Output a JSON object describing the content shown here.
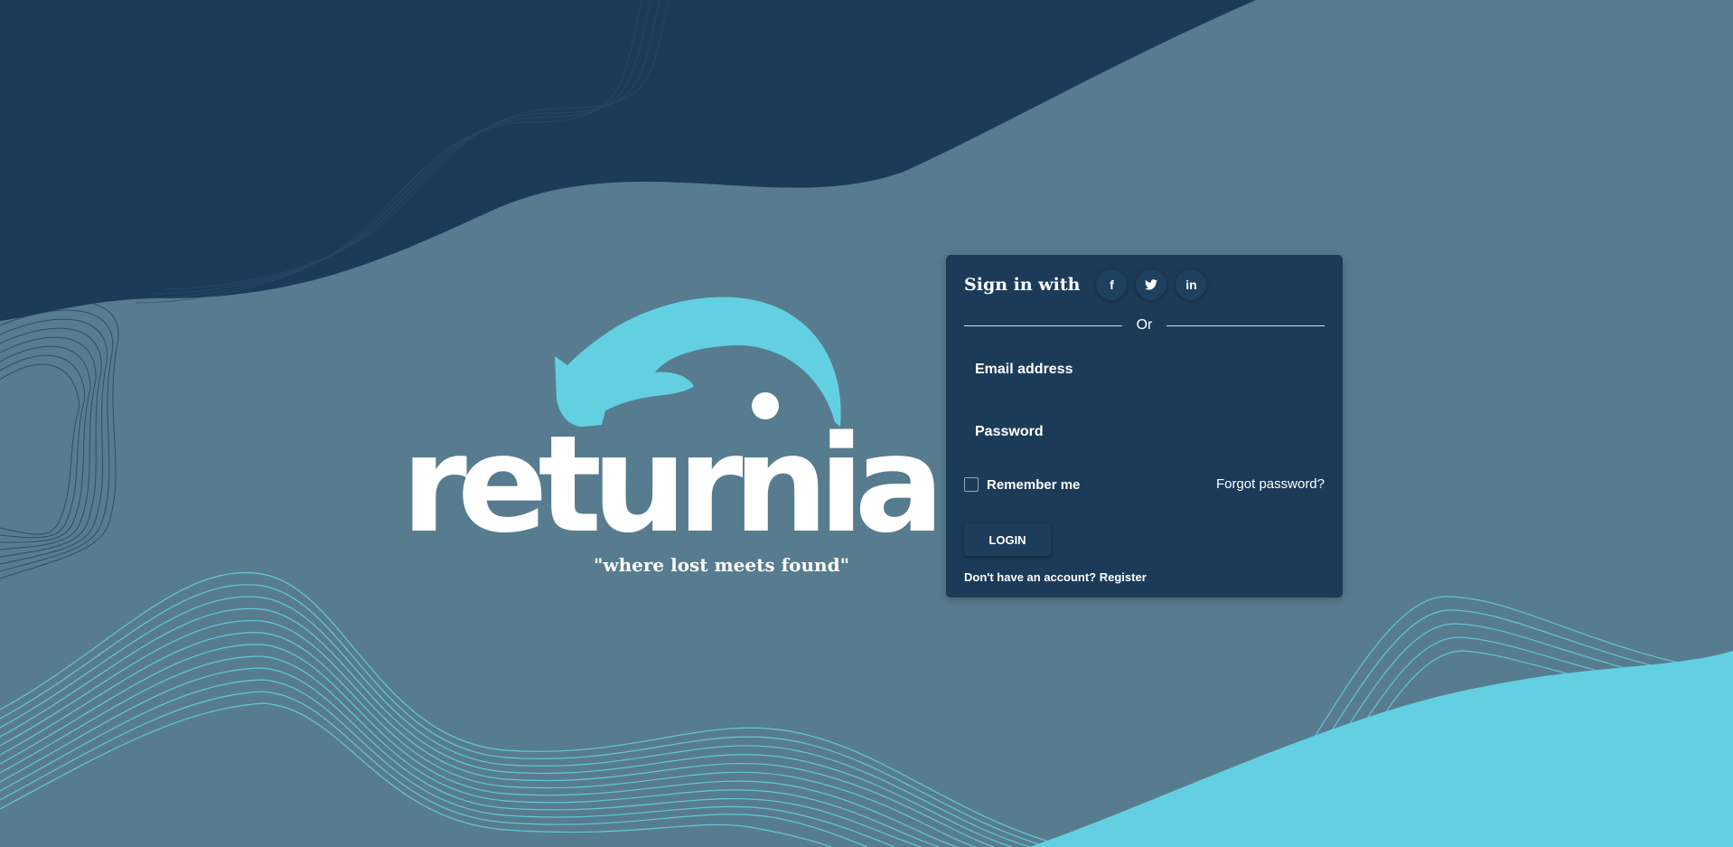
{
  "brand": {
    "wordmark": "returnia",
    "tagline": "\"where lost meets found\"",
    "accent_color": "#63d0e1"
  },
  "colors": {
    "background": "#577c8f",
    "dark_navy": "#1b3b59",
    "cyan": "#63d0e1",
    "card": "#1c3b59"
  },
  "login_card": {
    "signin_label": "Sign in with",
    "social": [
      {
        "icon": "facebook-icon",
        "glyph": "f"
      },
      {
        "icon": "twitter-icon",
        "glyph": "🐦"
      },
      {
        "icon": "linkedin-icon",
        "glyph": "in"
      }
    ],
    "divider_text": "Or",
    "email_placeholder": "Email address",
    "password_placeholder": "Password",
    "remember_label": "Remember me",
    "forgot_label": "Forgot password?",
    "login_label": "LOGIN",
    "register_prompt": "Don't have an account?",
    "register_link": "Register"
  }
}
